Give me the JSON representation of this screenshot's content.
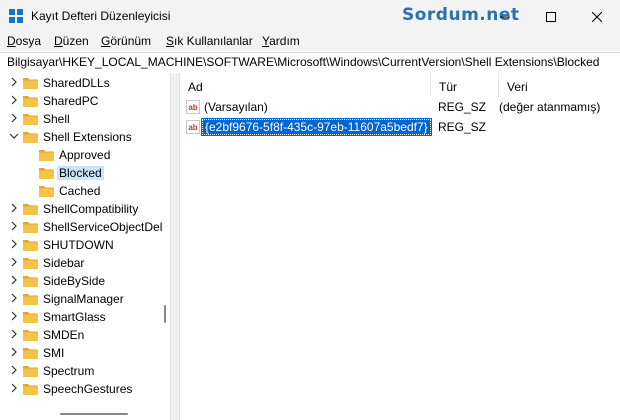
{
  "window": {
    "title": "Kayıt Defteri Düzenleyicisi",
    "watermark": "Sordum.net"
  },
  "menu": [
    {
      "label": "Dosya",
      "u": "D",
      "rest": "osya"
    },
    {
      "label": "Düzen",
      "u": "D",
      "rest": "üzen"
    },
    {
      "label": "Görünüm",
      "u": "G",
      "rest": "örünüm"
    },
    {
      "label": "Sık Kullanılanlar",
      "u": "S",
      "rest": "ık Kullanılanlar"
    },
    {
      "label": "Yardım",
      "u": "Y",
      "rest": "ardım"
    }
  ],
  "address": "Bilgisayar\\HKEY_LOCAL_MACHINE\\SOFTWARE\\Microsoft\\Windows\\CurrentVersion\\Shell Extensions\\Blocked",
  "tree": {
    "items": [
      {
        "label": "SharedDLLs",
        "level": 0,
        "expander": "collapsed"
      },
      {
        "label": "SharedPC",
        "level": 0,
        "expander": "collapsed"
      },
      {
        "label": "Shell",
        "level": 0,
        "expander": "collapsed"
      },
      {
        "label": "Shell Extensions",
        "level": 0,
        "expander": "expanded"
      },
      {
        "label": "Approved",
        "level": 1,
        "expander": "none"
      },
      {
        "label": "Blocked",
        "level": 1,
        "expander": "none",
        "selected": true
      },
      {
        "label": "Cached",
        "level": 1,
        "expander": "none"
      },
      {
        "label": "ShellCompatibility",
        "level": 0,
        "expander": "collapsed"
      },
      {
        "label": "ShellServiceObjectDel",
        "level": 0,
        "expander": "collapsed"
      },
      {
        "label": "SHUTDOWN",
        "level": 0,
        "expander": "collapsed"
      },
      {
        "label": "Sidebar",
        "level": 0,
        "expander": "collapsed"
      },
      {
        "label": "SideBySide",
        "level": 0,
        "expander": "collapsed"
      },
      {
        "label": "SignalManager",
        "level": 0,
        "expander": "collapsed"
      },
      {
        "label": "SmartGlass",
        "level": 0,
        "expander": "collapsed"
      },
      {
        "label": "SMDEn",
        "level": 0,
        "expander": "collapsed"
      },
      {
        "label": "SMI",
        "level": 0,
        "expander": "collapsed"
      },
      {
        "label": "Spectrum",
        "level": 0,
        "expander": "collapsed"
      },
      {
        "label": "SpeechGestures",
        "level": 0,
        "expander": "collapsed"
      }
    ]
  },
  "list": {
    "columns": {
      "name": "Ad",
      "type": "Tür",
      "data": "Veri"
    },
    "rows": [
      {
        "name": "(Varsayılan)",
        "type": "REG_SZ",
        "data": "(değer atanmamış)",
        "selected": false
      },
      {
        "name": "{e2bf9676-5f8f-435c-97eb-11607a5bedf7}",
        "type": "REG_SZ",
        "data": "",
        "selected": true
      }
    ]
  },
  "colors": {
    "selection": "#0064d2",
    "tree_selection": "#cce4f7",
    "folder": "#f3c34a",
    "accent": "#2d6fb3"
  }
}
